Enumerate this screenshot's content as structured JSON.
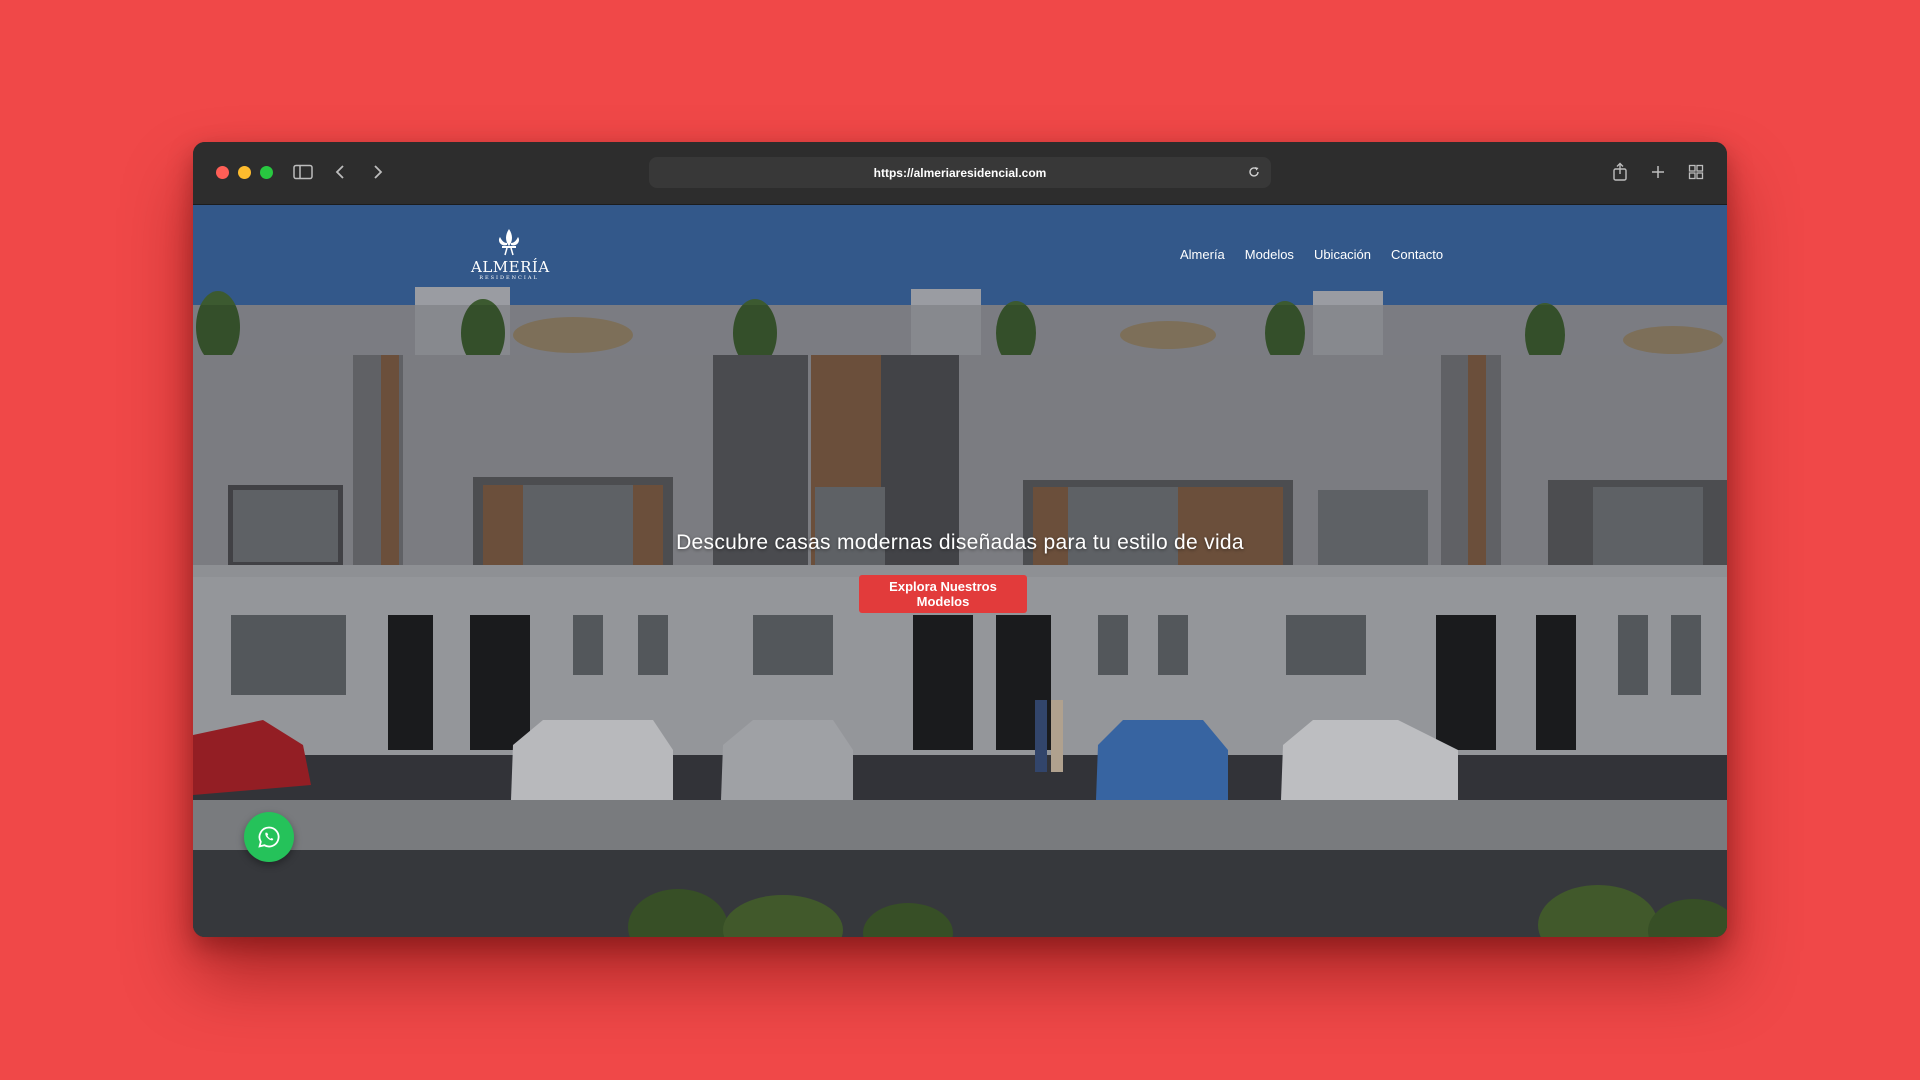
{
  "browser": {
    "url": "https://almeriaresidencial.com",
    "icons": [
      "sidebar-icon",
      "back-icon",
      "forward-icon",
      "reload-icon",
      "share-icon",
      "new-tab-icon",
      "tab-overview-icon"
    ]
  },
  "site": {
    "logo_name": "ALMERÍA",
    "logo_sub": "RESIDENCIAL",
    "nav": [
      "Almería",
      "Modelos",
      "Ubicación",
      "Contacto"
    ],
    "hero_title": "Descubre casas modernas diseñadas para tu estilo de vida",
    "cta_label": "Explora Nuestros Modelos",
    "floating_icon": "whatsapp-icon"
  },
  "colors": {
    "background": "#f04848",
    "nav_bar": "#33588a",
    "cta": "#e23b3b",
    "whatsapp": "#25c25a"
  }
}
